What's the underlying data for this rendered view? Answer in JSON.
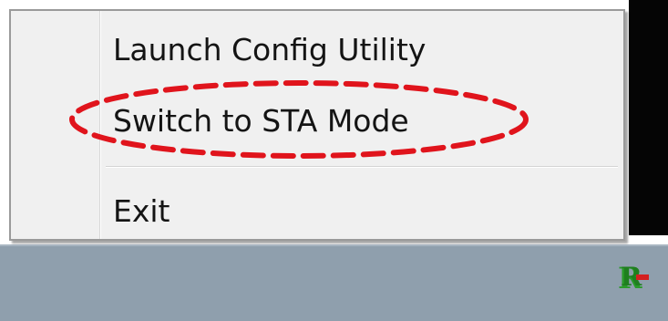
{
  "context_menu": {
    "items": [
      {
        "label": "Launch Config Utility"
      },
      {
        "label": "Switch to STA Mode"
      },
      {
        "label": "Exit"
      }
    ]
  },
  "annotation": {
    "highlighted_item": "Switch to STA Mode",
    "style": "dashed-red-ellipse",
    "color": "#e0141c"
  },
  "colors": {
    "menu_background": "#f0f0f0",
    "menu_border": "#9a9a9a",
    "taskbar": "#8f9fad",
    "tray_icon_red": "#d42020",
    "tray_icon_green": "#2a9a2a"
  },
  "taskbar": {
    "tray_icons": [
      {
        "name": "wireless-utility-tray-icon"
      }
    ]
  }
}
